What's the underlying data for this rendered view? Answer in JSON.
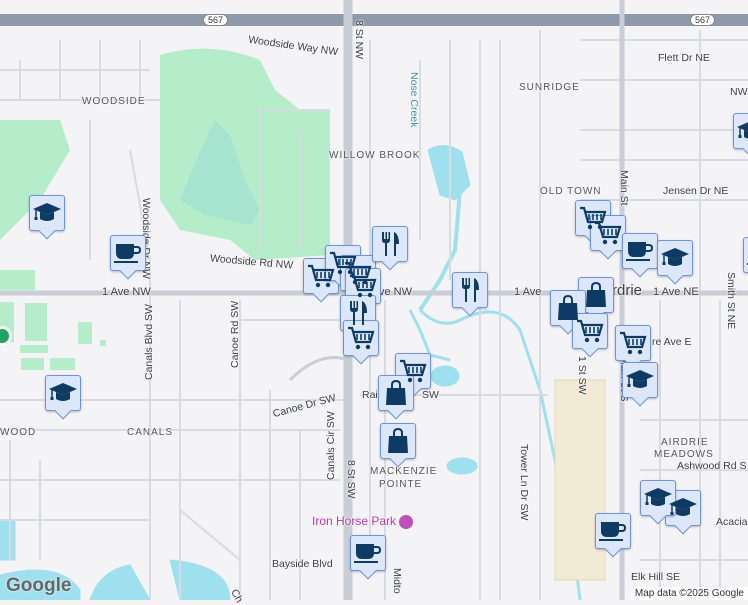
{
  "map": {
    "highway_shield": "567",
    "roads": {
      "woodside_way": "Woodside Way NW",
      "eighth_st_nw": "8 St NW",
      "eighth_st_sw": "8 St SW",
      "woodside_rd": "Woodside Rd NW",
      "first_ave_nw": "1 Ave NW",
      "first_ave_nw_partial": "ve NW",
      "first_ave_partial": "1 Ave",
      "first_ave_ne": "1 Ave NE",
      "canals_blvd": "Canals Blvd SW",
      "canoe_rd": "Canoe Rd SW",
      "canoe_dr": "Canoe Dr SW",
      "railway": "Rail",
      "railway_tail": "SW",
      "canals_cir": "Canals Cir SW",
      "tower_ln": "Tower Ln Dr SW",
      "main_st": "Main St",
      "main_st_s": "Main St S",
      "first_st_sw": "1 St SW",
      "flett_dr": "Flett Dr NE",
      "jensen_dr": "Jensen Dr NE",
      "smith_st": "Smith St NE",
      "centre_ave": "re Ave E",
      "ashwood_rd": "Ashwood Rd S",
      "acacia": "Acacia",
      "bayside_blvd": "Bayside Blvd",
      "midtown": "Midto",
      "elk_hill": "Elk Hill SE",
      "woodside_dr": "Woodside Dr NW",
      "nose_creek": "Nose Creek",
      "cha": "Ch"
    },
    "areas": {
      "woodside": "WOODSIDE",
      "willowbrook": "WILLOW BROOK",
      "sunridge": "SUNRIDGE",
      "old_town": "OLD TOWN",
      "canals": "CANALS",
      "wood": "WOOD",
      "mackenzie": "MACKENZIE",
      "pointe": "POINTE",
      "airdrie_meadows_1": "AIRDRIE",
      "airdrie_meadows_2": "MEADOWS",
      "airdrie_city": "rdrie",
      "nw_partial": "NW"
    },
    "poi": {
      "iron_horse_park": "Iron Horse Park"
    },
    "markers": [
      "cart",
      "cart",
      "cart",
      "cart",
      "cutlery",
      "cart",
      "cutlery",
      "cutlery",
      "cart",
      "bag",
      "bag",
      "cup",
      "cup",
      "graduation",
      "graduation",
      "cart",
      "cart",
      "cup",
      "graduation",
      "bag",
      "bag",
      "cart",
      "cart",
      "graduation",
      "graduation",
      "graduation",
      "cup",
      "cup",
      "graduation"
    ],
    "colors": {
      "marker_bg": "#dde7fb",
      "marker_border": "#6d93da",
      "icon": "#0d3b66",
      "water": "#9ee0ee",
      "park": "#b5ecc9"
    }
  },
  "footer": {
    "logo": "Google",
    "attribution": "Map data ©2025 Google"
  }
}
